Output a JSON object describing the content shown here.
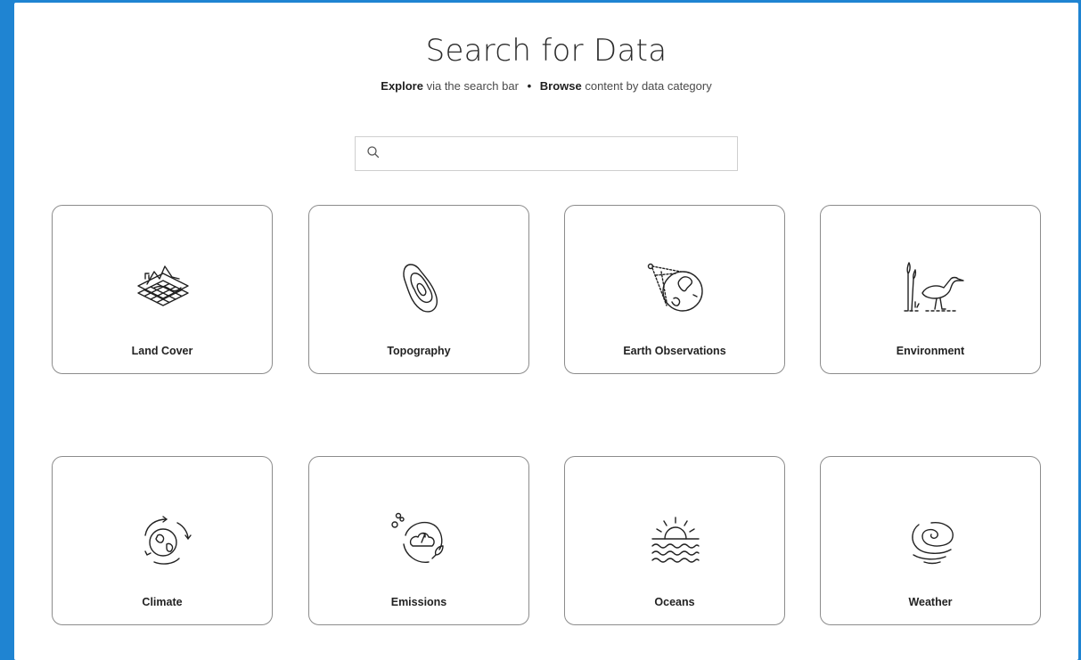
{
  "header": {
    "title": "Search for Data",
    "subtitle": {
      "explore_bold": "Explore",
      "explore_rest": "via the search bar",
      "separator": "•",
      "browse_bold": "Browse",
      "browse_rest": "content by data category"
    }
  },
  "search": {
    "value": "",
    "placeholder": "",
    "icon": "search-icon"
  },
  "categories": [
    {
      "label": "Land Cover",
      "icon": "land-cover-icon"
    },
    {
      "label": "Topography",
      "icon": "topography-icon"
    },
    {
      "label": "Earth Observations",
      "icon": "earth-observations-icon"
    },
    {
      "label": "Environment",
      "icon": "environment-icon"
    },
    {
      "label": "Climate",
      "icon": "climate-icon"
    },
    {
      "label": "Emissions",
      "icon": "emissions-icon"
    },
    {
      "label": "Oceans",
      "icon": "oceans-icon"
    },
    {
      "label": "Weather",
      "icon": "weather-icon"
    }
  ],
  "colors": {
    "background": "#1f84d2",
    "panel": "#ffffff",
    "card_border": "#8c8c8c",
    "text": "#222222"
  }
}
